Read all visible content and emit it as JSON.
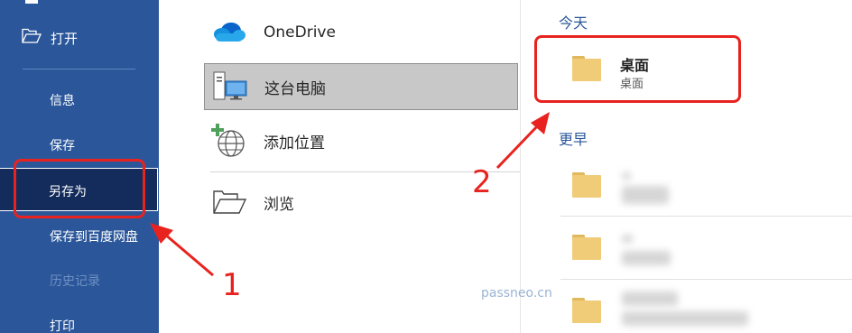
{
  "sidebar": {
    "open_label": "打开",
    "items": [
      {
        "label": "信息"
      },
      {
        "label": "保存"
      },
      {
        "label": "另存为"
      },
      {
        "label": "保存到百度网盘"
      },
      {
        "label": "历史记录"
      },
      {
        "label": "打印"
      }
    ],
    "selected_item": "另存为"
  },
  "locations": [
    {
      "label": "OneDrive",
      "icon": "onedrive-cloud-icon"
    },
    {
      "label": "这台电脑",
      "icon": "this-pc-icon"
    },
    {
      "label": "添加位置",
      "icon": "add-location-globe-icon"
    },
    {
      "label": "浏览",
      "icon": "folder-open-icon"
    }
  ],
  "recent": {
    "today_header": "今天",
    "earlier_header": "更早",
    "today_items": [
      {
        "title": "桌面",
        "path": "桌面"
      }
    ]
  },
  "annotations": {
    "step1": "1",
    "step2": "2",
    "watermark": "passneo.cn"
  },
  "colors": {
    "sidebar_bg": "#2b579a",
    "sidebar_selected_bg": "#132c5c",
    "annotation_red": "#e8231f",
    "folder_yellow": "#f0cc79",
    "header_blue": "#2b579a"
  }
}
